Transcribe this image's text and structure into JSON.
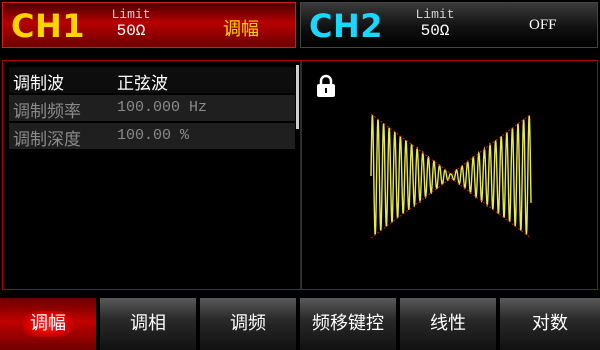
{
  "ch1": {
    "label": "CH1",
    "limit_key": "Limit",
    "limit_value": "50Ω",
    "mode": "调幅"
  },
  "ch2": {
    "label": "CH2",
    "limit_key": "Limit",
    "limit_value": "50Ω",
    "mode": "OFF"
  },
  "params": [
    {
      "label": "调制波",
      "value": "正弦波"
    },
    {
      "label": "调制频率",
      "value": "100.000 Hz"
    },
    {
      "label": "调制深度",
      "value": "100.00 %"
    }
  ],
  "menu": [
    "调幅",
    "调相",
    "调频",
    "频移键控",
    "线性",
    "对数"
  ],
  "colors": {
    "ch1": "#ffd400",
    "ch2": "#19d7ff",
    "accent_red": "#c00000",
    "waveform": "#e8e84a",
    "envelope": "#d21a1a"
  },
  "icons": {
    "lock": "lock-icon"
  }
}
